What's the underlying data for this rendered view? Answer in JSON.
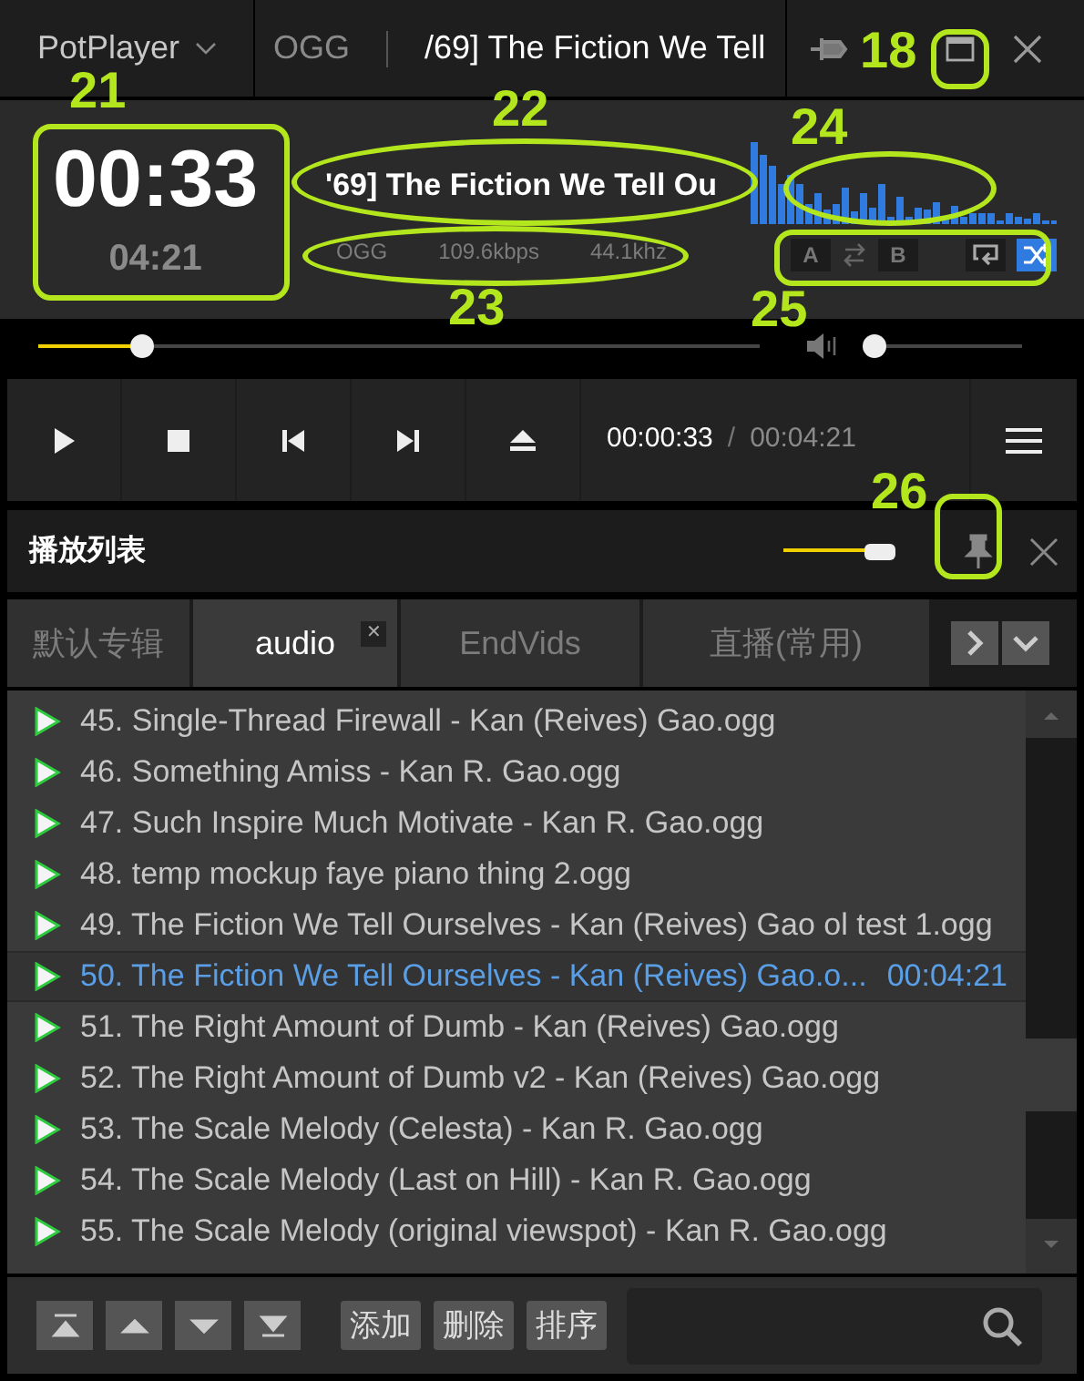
{
  "title_bar": {
    "app_menu": "PotPlayer",
    "format": "OGG",
    "title": "/69] The Fiction We Tell"
  },
  "info": {
    "elapsed": "00:33",
    "total": "04:21",
    "track_title": "'69] The Fiction We Tell Ou",
    "format": "OGG",
    "bitrate": "109.6kbps",
    "sample_rate": "44.1khz"
  },
  "ab_buttons": [
    {
      "label": "A",
      "kind": "a",
      "on": false
    },
    {
      "label": "B",
      "kind": "b",
      "on": false
    }
  ],
  "repeat": {
    "on": false
  },
  "shuffle": {
    "on": true
  },
  "seek": {
    "level": 0.145
  },
  "volume": {
    "level": 0.06
  },
  "controls": {
    "current_time": "00:00:33",
    "separator": "/",
    "total_time": "00:04:21"
  },
  "playlist": {
    "title": "播放列表",
    "opacity": {
      "level": 0.88
    },
    "tabs": [
      {
        "label": "默认专辑",
        "selected": false
      },
      {
        "label": "audio",
        "selected": true,
        "close": "✕"
      },
      {
        "label": "EndVids",
        "selected": false
      },
      {
        "label": "直播(常用)",
        "selected": false
      }
    ],
    "items": [
      {
        "name": "45. Single-Thread Firewall - Kan (Reives) Gao.ogg",
        "selected": false
      },
      {
        "name": "46. Something Amiss - Kan R. Gao.ogg",
        "selected": false
      },
      {
        "name": "47. Such Inspire Much Motivate - Kan R. Gao.ogg",
        "selected": false
      },
      {
        "name": "48. temp mockup faye piano thing 2.ogg",
        "selected": false
      },
      {
        "name": "49. The Fiction We Tell Ourselves - Kan (Reives) Gao ol test 1.ogg",
        "selected": false
      },
      {
        "name": "50. The Fiction We Tell Ourselves - Kan (Reives) Gao.o...",
        "selected": true,
        "duration": "00:04:21"
      },
      {
        "name": "51. The Right Amount of Dumb - Kan (Reives) Gao.ogg",
        "selected": false
      },
      {
        "name": "52. The Right Amount of Dumb v2 - Kan (Reives) Gao.ogg",
        "selected": false
      },
      {
        "name": "53. The Scale Melody (Celesta) - Kan R. Gao.ogg",
        "selected": false
      },
      {
        "name": "54. The Scale Melody (Last on Hill) - Kan R. Gao.ogg",
        "selected": false
      },
      {
        "name": "55. The Scale Melody (original viewspot) - Kan R. Gao.ogg",
        "selected": false
      }
    ],
    "actions": [
      "添加",
      "删除",
      "排序"
    ]
  },
  "annotations": [
    {
      "label": "18"
    },
    {
      "label": "21"
    },
    {
      "label": "22"
    },
    {
      "label": "23"
    },
    {
      "label": "24"
    },
    {
      "label": "25"
    },
    {
      "label": "26"
    }
  ]
}
